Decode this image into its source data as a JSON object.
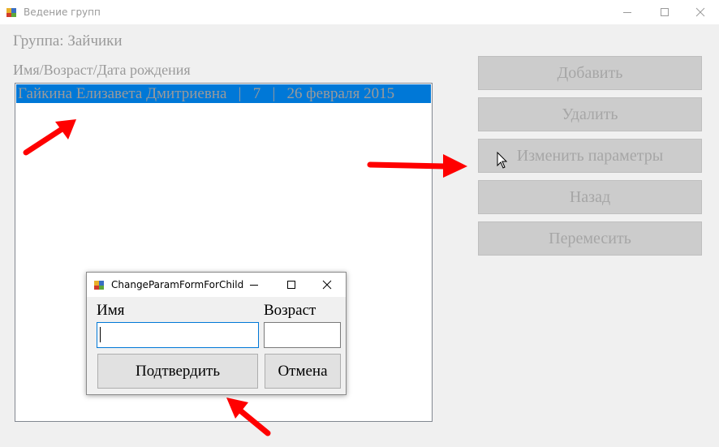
{
  "window": {
    "title": "Ведение групп",
    "controls": [
      "minimize-icon",
      "maximize-icon",
      "close-icon"
    ]
  },
  "main": {
    "group_label": "Группа: Зайчики",
    "columns_label": "Имя/Возраст/Дата рождения",
    "list_items": [
      {
        "text": "Гайкина Елизавета Дмитриевна   |   7   |   26 февраля 2015",
        "selected": true
      }
    ]
  },
  "actions": {
    "add": "Добавить",
    "delete": "Удалить",
    "change_params": "Изменить параметры",
    "back": "Назад",
    "move": "Перемесить"
  },
  "dialog": {
    "title": "ChangeParamFormForChild",
    "name_label": "Имя",
    "age_label": "Возраст",
    "name_value": "",
    "age_value": "",
    "confirm": "Подтвердить",
    "cancel": "Отмена"
  },
  "colors": {
    "selection": "#0078d7",
    "annotation_arrow": "#ff0000",
    "disabled_text": "#9a9a9a"
  }
}
